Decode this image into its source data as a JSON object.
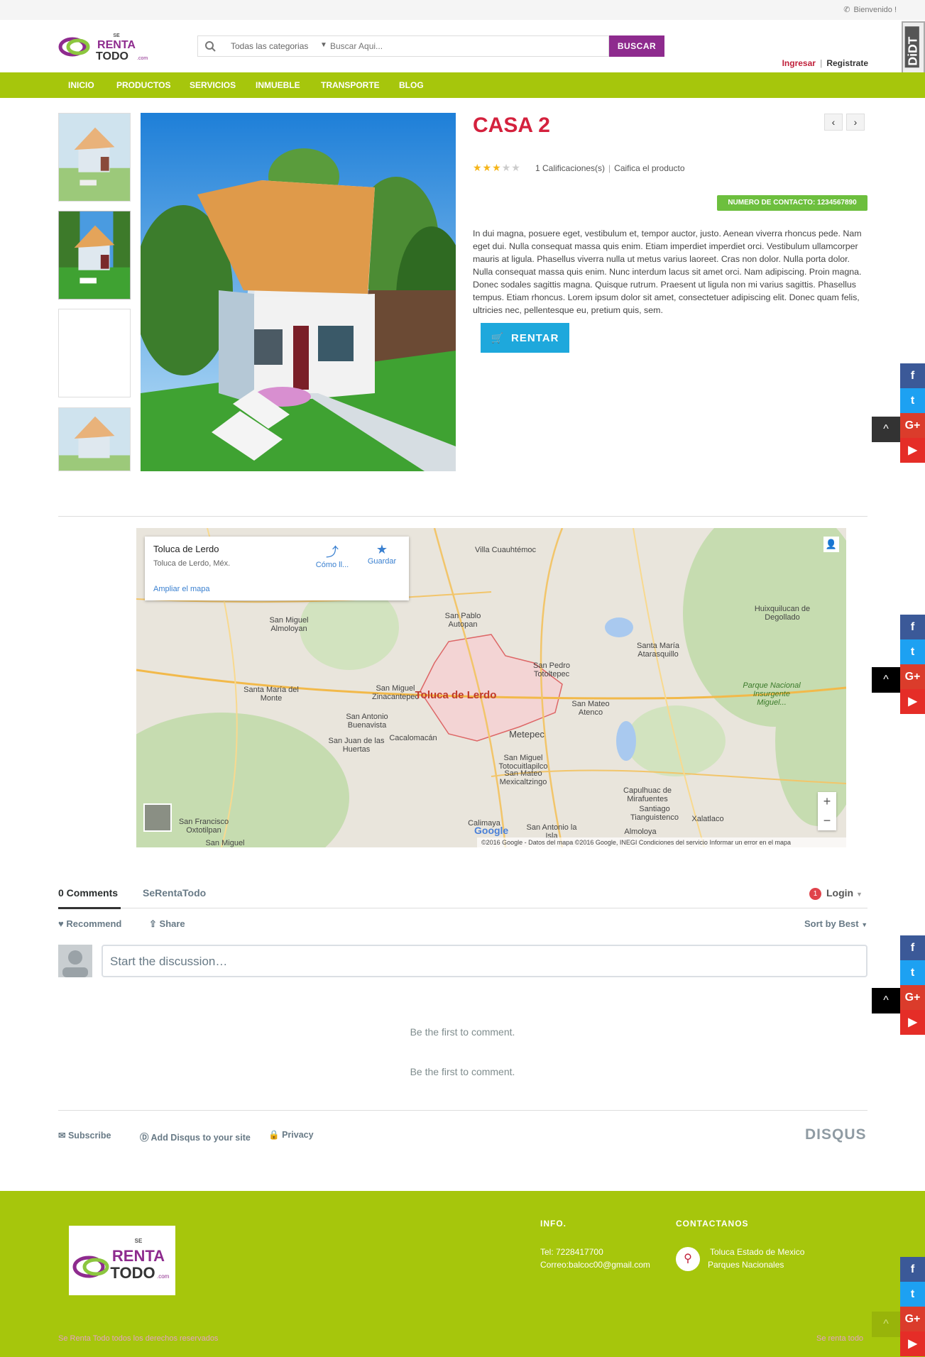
{
  "topbar": {
    "welcome": "Bienvenido !"
  },
  "header": {
    "logo_alt": "SE RENTA TODO.com",
    "search_category": "Todas las categorias",
    "search_placeholder": "Buscar Aqui...",
    "search_button": "BUSCAR",
    "login": "Ingresar",
    "register": "Registrate",
    "badge": "DiDT"
  },
  "nav": [
    "INICIO",
    "PRODUCTOS",
    "SERVICIOS",
    "INMUEBLE",
    "TRANSPORTE",
    "BLOG"
  ],
  "product": {
    "title": "CASA 2",
    "rating": 3,
    "rating_max": 5,
    "ratings_count": "1 Calificaciones(s)",
    "rate_link": "Caifica el producto",
    "contact": "NUMERO DE CONTACTO: 1234567890",
    "description": "In dui magna, posuere eget, vestibulum et, tempor auctor, justo. Aenean viverra rhoncus pede. Nam eget dui. Nulla consequat massa quis enim. Etiam imperdiet imperdiet orci. Vestibulum ullamcorper mauris at ligula. Phasellus viverra nulla ut metus varius laoreet. Cras non dolor. Nulla porta dolor. Nulla consequat massa quis enim. Nunc interdum lacus sit amet orci. Nam adipiscing. Proin magna. Donec sodales sagittis magna. Quisque rutrum. Praesent ut ligula non mi varius sagittis. Phasellus tempus. Etiam rhoncus. Lorem ipsum dolor sit amet, consectetuer adipiscing elit. Donec quam felis, ultricies nec, pellentesque eu, pretium quis, sem.",
    "rent_button": "RENTAR",
    "prev_icon": "‹",
    "next_icon": "›"
  },
  "map": {
    "place_title": "Toluca de Lerdo",
    "place_sub": "Toluca de Lerdo, Méx.",
    "enlarge": "Ampliar el mapa",
    "directions": "Cómo ll...",
    "save": "Guardar",
    "city": "Toluca de Lerdo",
    "labels": [
      {
        "text": "Villa Cuauhtémoc"
      },
      {
        "text": "Huixquilucan de Degollado"
      },
      {
        "text": "San Miguel Almoloyan"
      },
      {
        "text": "San Pablo Autopan"
      },
      {
        "text": "Santa María Atarasquillo"
      },
      {
        "text": "San Pedro Totoltepec"
      },
      {
        "text": "Santa María del Monte"
      },
      {
        "text": "San Miguel Zinacantepec"
      },
      {
        "text": "San Mateo Atenco"
      },
      {
        "text": "Parque Nacional Insurgente Miguel..."
      },
      {
        "text": "San Antonio Buenavista"
      },
      {
        "text": "Cacalomacán"
      },
      {
        "text": "Metepec"
      },
      {
        "text": "San Juan de las Huertas"
      },
      {
        "text": "San Miguel Totocuitlapilco"
      },
      {
        "text": "San Mateo Mexicaltzingo"
      },
      {
        "text": "Capulhuac de Mirafuentes"
      },
      {
        "text": "Santiago Tianguistenco"
      },
      {
        "text": "Xalatlaco"
      },
      {
        "text": "San Francisco Oxtotilpan"
      },
      {
        "text": "Calimaya"
      },
      {
        "text": "San Antonio la Isla"
      },
      {
        "text": "Almoloya"
      },
      {
        "text": "San Miguel"
      }
    ],
    "footer": "©2016 Google - Datos del mapa ©2016 Google, INEGI    Condiciones del servicio    Informar un error en el mapa",
    "google": "Google",
    "zoom_in": "+",
    "zoom_out": "−"
  },
  "disqus": {
    "comments_tab": "0 Comments",
    "site_tab": "SeRentaTodo",
    "login": "Login",
    "login_badge": "1",
    "recommend": "Recommend",
    "share": "Share",
    "sort": "Sort by Best",
    "placeholder": "Start the discussion…",
    "first1": "Be the first to comment.",
    "first2": "Be the first to comment.",
    "subscribe": "Subscribe",
    "add": "Add Disqus to your site",
    "privacy": "Privacy",
    "brand": "DISQUS"
  },
  "footer": {
    "info_head": "INFO.",
    "phone": "Tel: 7228417700",
    "email": "Correo:balcoc00@gmail.com",
    "contact_head": "CONTACTANOS",
    "address1": "Toluca Estado de Mexico",
    "address2": "Parques Nacionales",
    "copyright": "Se Renta Todo todos los derechos reservados",
    "copyright_right": "Se renta todo"
  },
  "social": {
    "facebook": "f",
    "twitter": "t",
    "googleplus": "G+",
    "youtube": "▶",
    "totop": "^"
  },
  "colors": {
    "accent_green": "#a6c60c",
    "brand_red": "#d4213d",
    "buy_purple": "#8e2b8e",
    "rent_blue": "#1ea8dc",
    "contact_green": "#6dbf3e"
  }
}
